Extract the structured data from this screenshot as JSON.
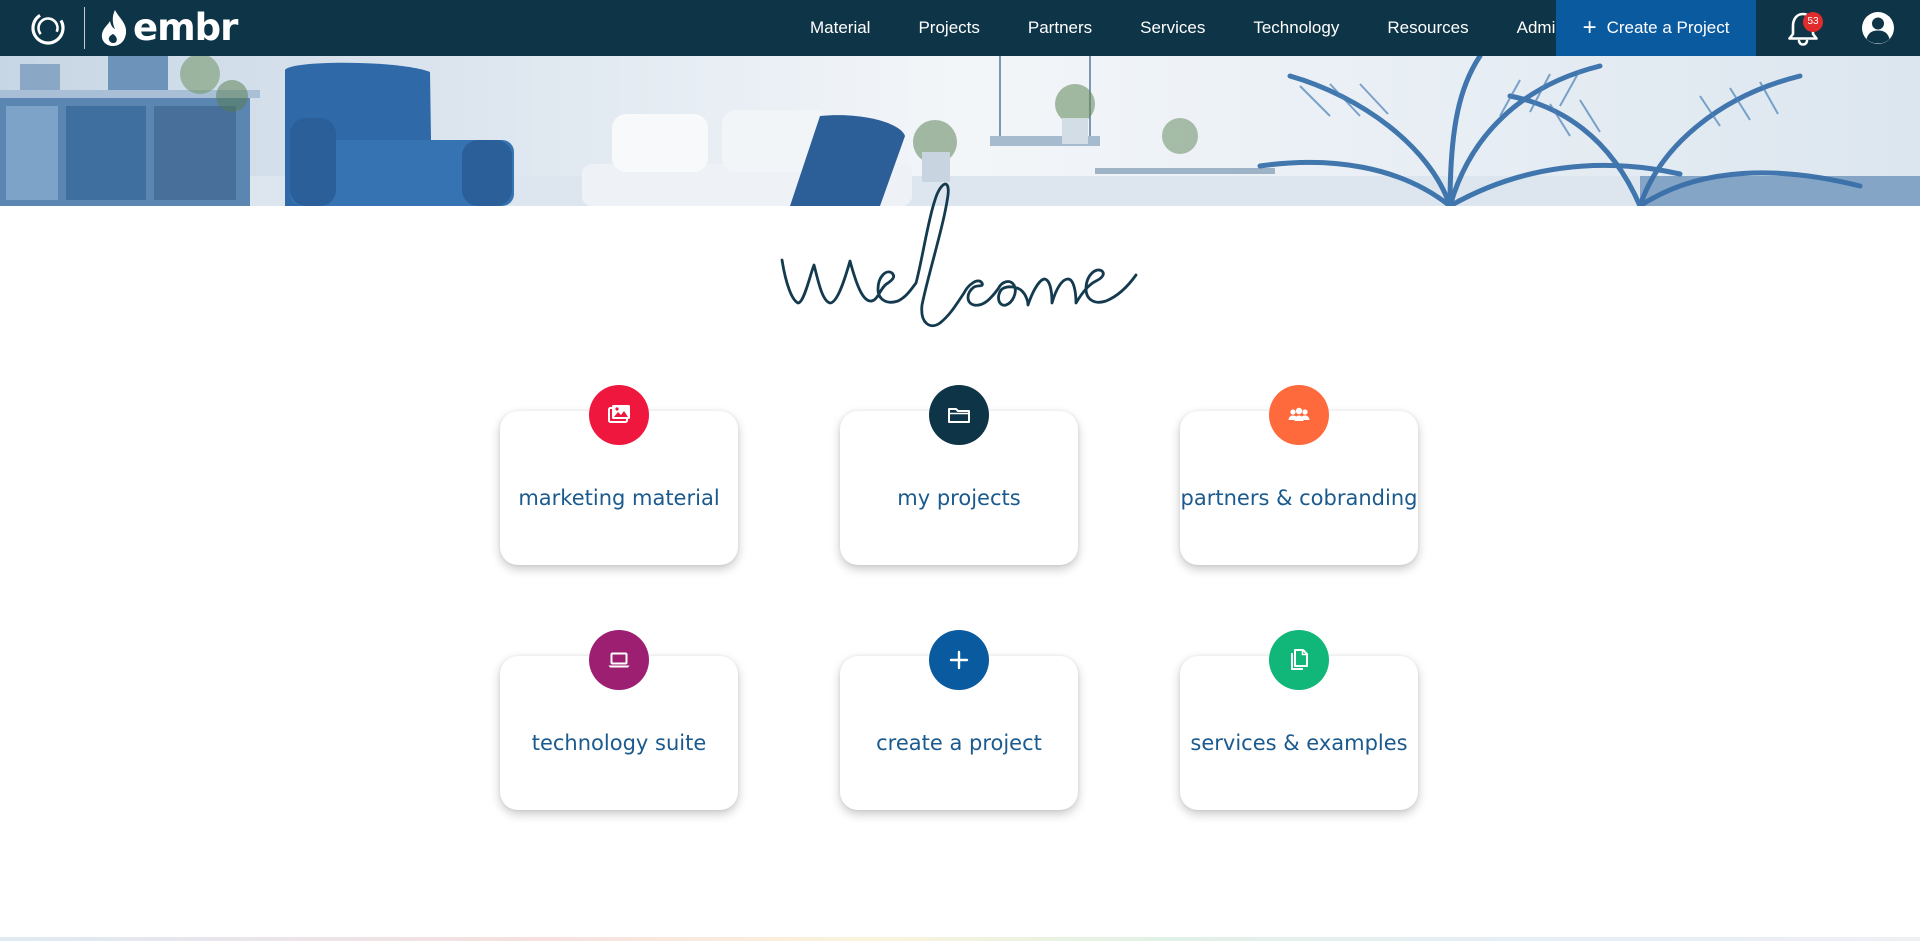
{
  "header": {
    "brand_name": "embr",
    "nav": [
      "Material",
      "Projects",
      "Partners",
      "Services",
      "Technology",
      "Resources",
      "Admin"
    ],
    "cta_label": "Create a Project",
    "notification_count": "53",
    "colors": {
      "bar": "#0d3447",
      "cta": "#0a5aa0",
      "badge": "#e02c2c"
    }
  },
  "welcome_text": "welcome",
  "cards": [
    {
      "label": "marketing material",
      "icon": "images-icon",
      "color": "#f0173f"
    },
    {
      "label": "my projects",
      "icon": "folder-icon",
      "color": "#0d3447"
    },
    {
      "label": "partners & cobranding",
      "icon": "people-icon",
      "color": "#ff6a3d"
    },
    {
      "label": "technology suite",
      "icon": "laptop-icon",
      "color": "#9c1f71"
    },
    {
      "label": "create a project",
      "icon": "plus-icon",
      "color": "#0a5aa0"
    },
    {
      "label": "services & examples",
      "icon": "documents-icon",
      "color": "#11b679"
    }
  ]
}
